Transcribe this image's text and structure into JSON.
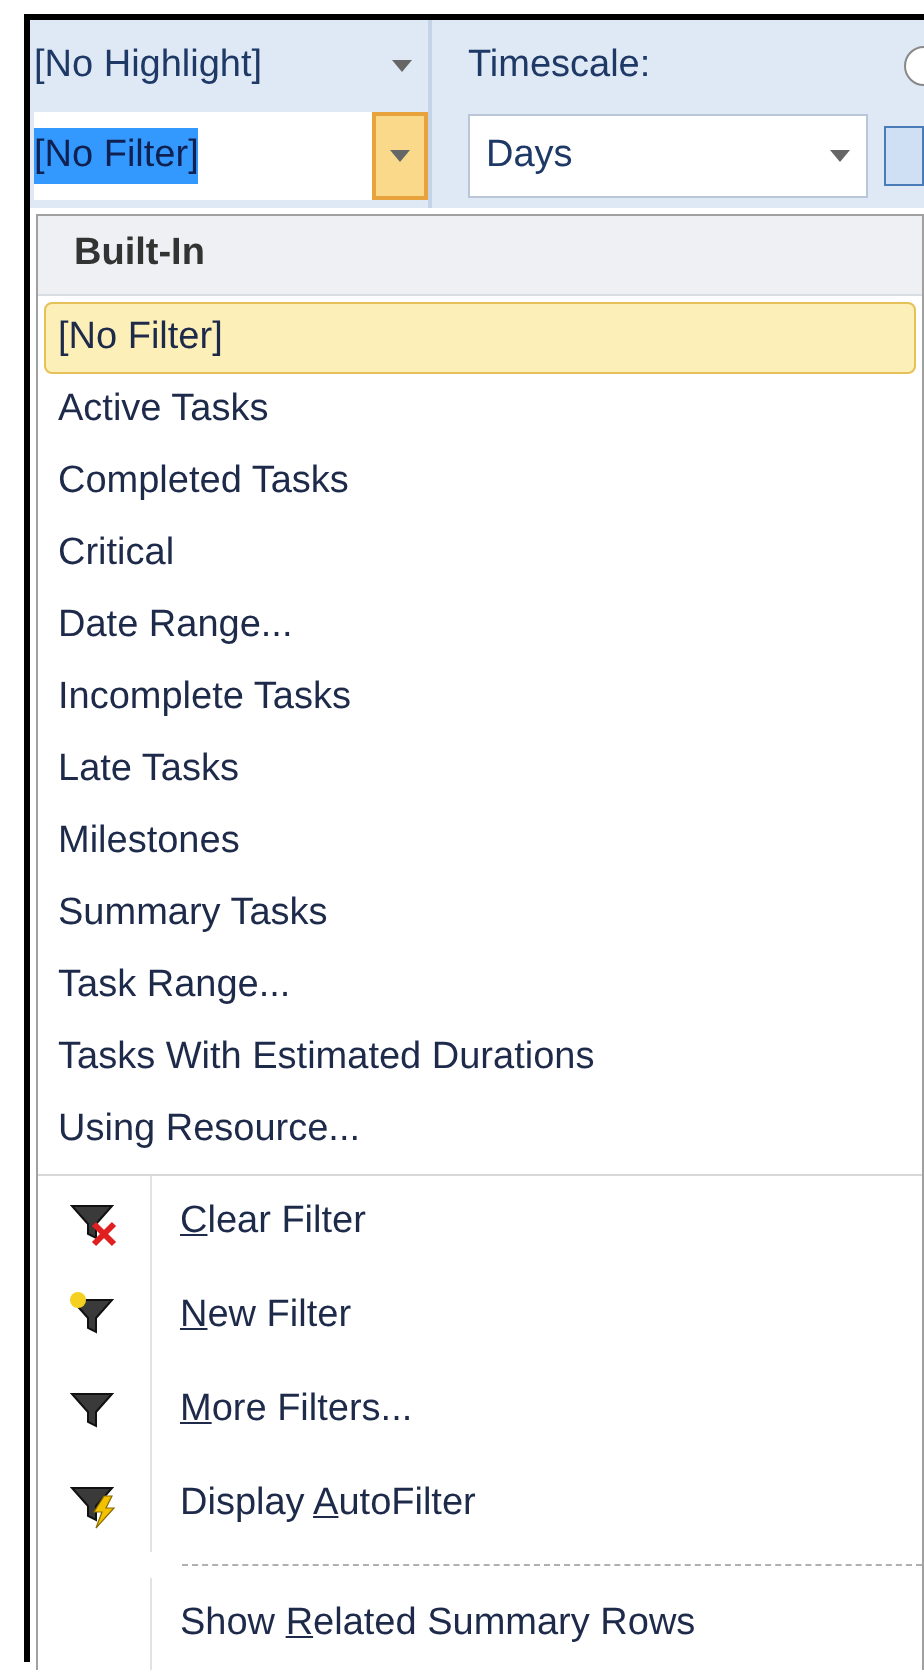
{
  "ribbon": {
    "highlight": {
      "value": "[No Highlight]"
    },
    "filter": {
      "value": "[No Filter]",
      "open": true
    },
    "timescale": {
      "label": "Timescale:",
      "value": "Days"
    }
  },
  "menu": {
    "header": "Built-In",
    "filters": [
      {
        "label": "[No Filter]",
        "selected": true
      },
      {
        "label": "Active Tasks",
        "selected": false
      },
      {
        "label": "Completed Tasks",
        "selected": false
      },
      {
        "label": "Critical",
        "selected": false
      },
      {
        "label": "Date Range...",
        "selected": false
      },
      {
        "label": "Incomplete Tasks",
        "selected": false
      },
      {
        "label": "Late Tasks",
        "selected": false
      },
      {
        "label": "Milestones",
        "selected": false
      },
      {
        "label": "Summary Tasks",
        "selected": false
      },
      {
        "label": "Task Range...",
        "selected": false
      },
      {
        "label": "Tasks With Estimated Durations",
        "selected": false
      },
      {
        "label": "Using Resource...",
        "selected": false
      }
    ],
    "commands": [
      {
        "kind": "clear",
        "label": {
          "access_key": "C",
          "after": "lear Filter"
        }
      },
      {
        "kind": "new",
        "label": {
          "access_key": "N",
          "after": "ew Filter"
        }
      },
      {
        "kind": "more",
        "label": {
          "access_key": "M",
          "after": "ore Filters..."
        }
      },
      {
        "kind": "autofilter",
        "label": {
          "before": "Display ",
          "access_key": "A",
          "after": "utoFilter"
        }
      },
      {
        "kind": "plain",
        "label": {
          "before": "Show ",
          "access_key": "R",
          "after": "elated Summary Rows"
        }
      }
    ]
  }
}
